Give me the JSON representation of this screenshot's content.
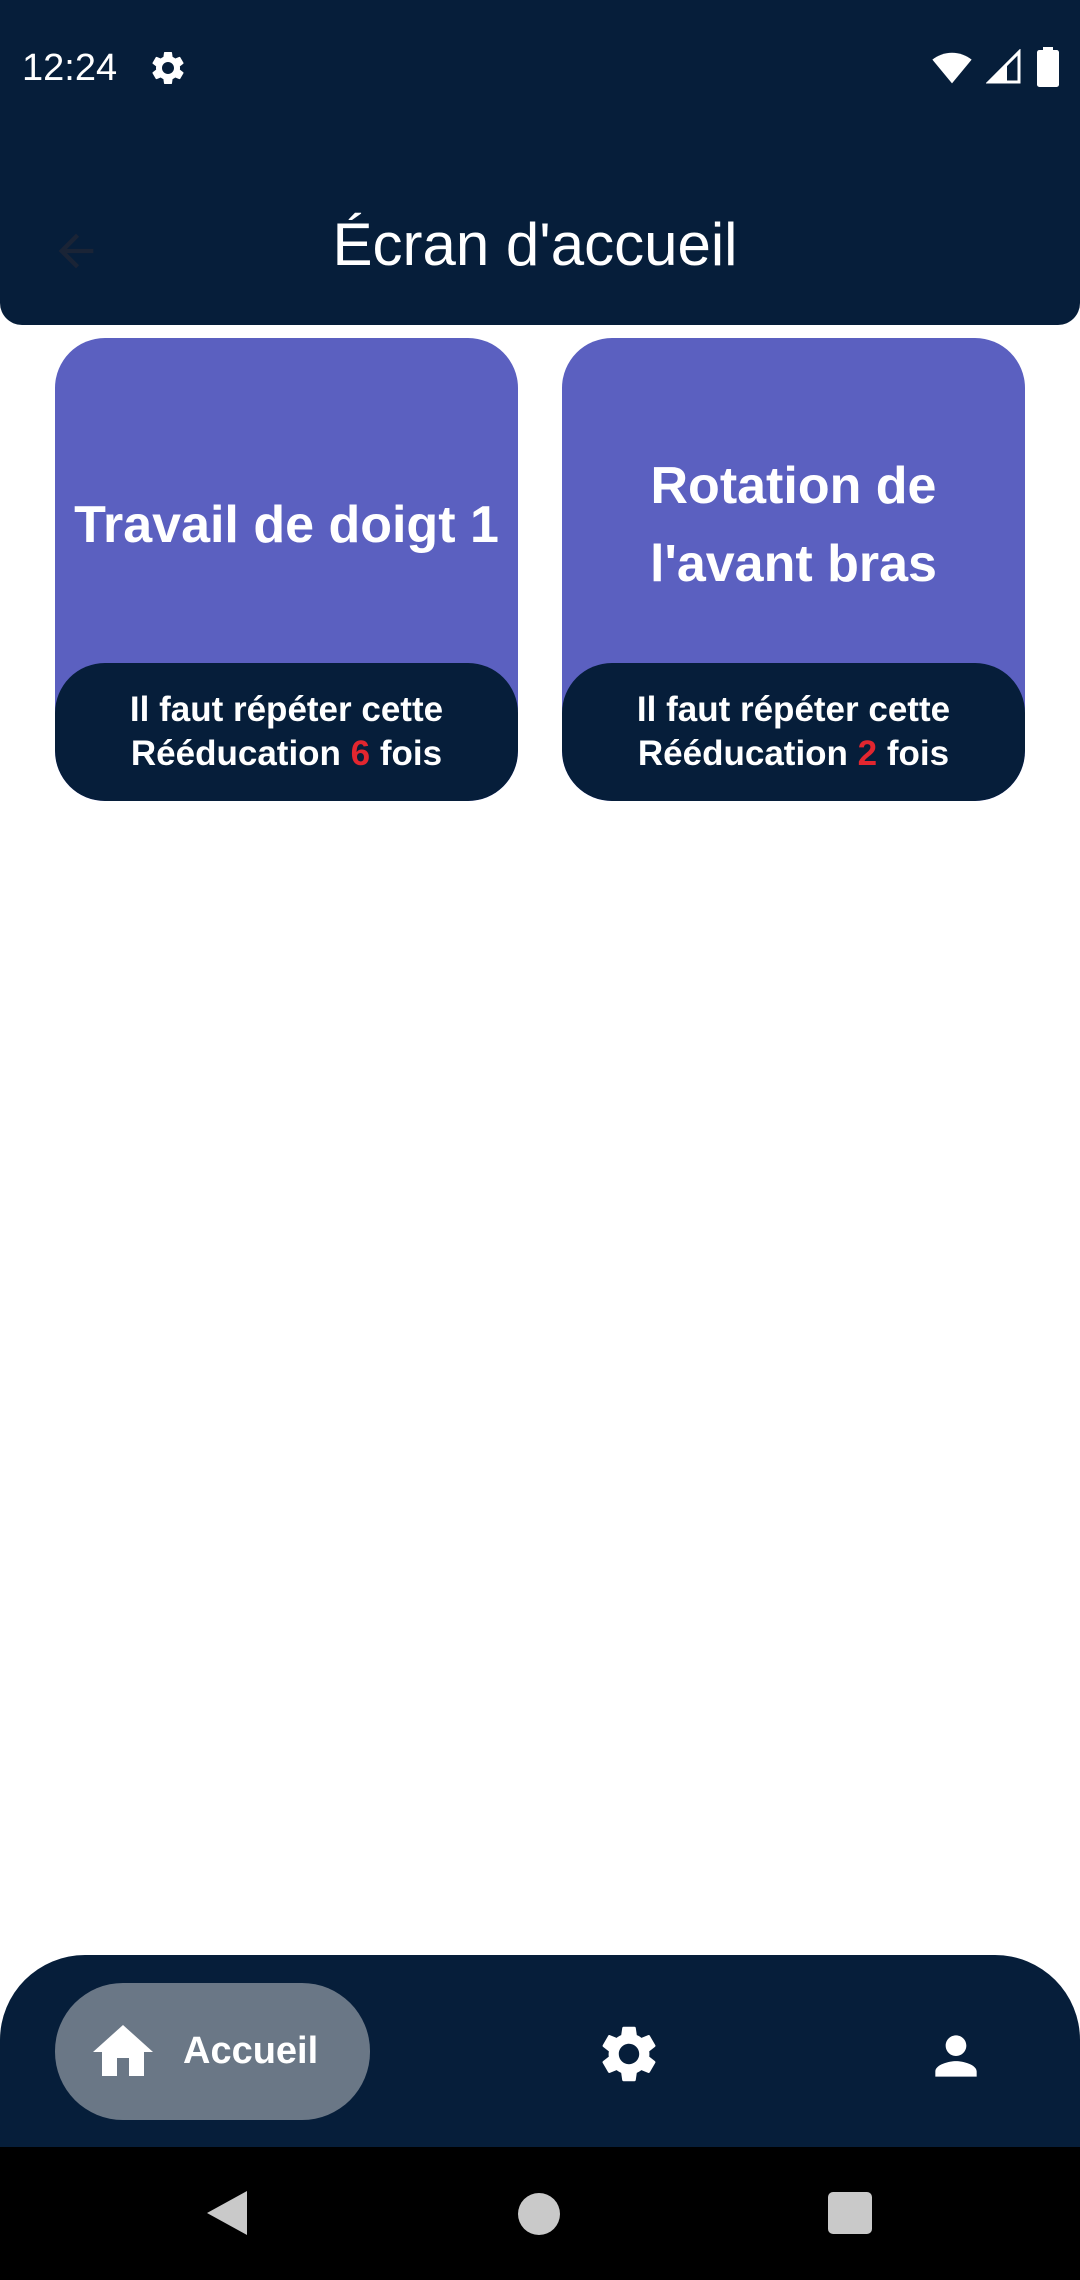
{
  "status_bar": {
    "time": "12:24",
    "icons": [
      "gear-icon",
      "wifi-icon",
      "signal-icon",
      "battery-icon"
    ]
  },
  "app_bar": {
    "title": "Écran d'accueil",
    "back_icon": "arrow-left-icon"
  },
  "cards": [
    {
      "title": "Travail de doigt 1",
      "footer_prefix": "Il faut répéter cette",
      "footer_word": "Rééducation",
      "count": "6",
      "footer_suffix": "fois"
    },
    {
      "title": "Rotation de l'avant bras",
      "footer_prefix": "Il faut répéter cette",
      "footer_word": "Rééducation",
      "count": "2",
      "footer_suffix": "fois"
    }
  ],
  "bottom_nav": {
    "home_label": "Accueil",
    "items": [
      "home-icon",
      "gear-icon",
      "person-icon"
    ]
  },
  "colors": {
    "dark_navy": "#061e3a",
    "card_purple": "#5b60c0",
    "count_red": "#e2262f",
    "nav_active": "#6a7786"
  }
}
